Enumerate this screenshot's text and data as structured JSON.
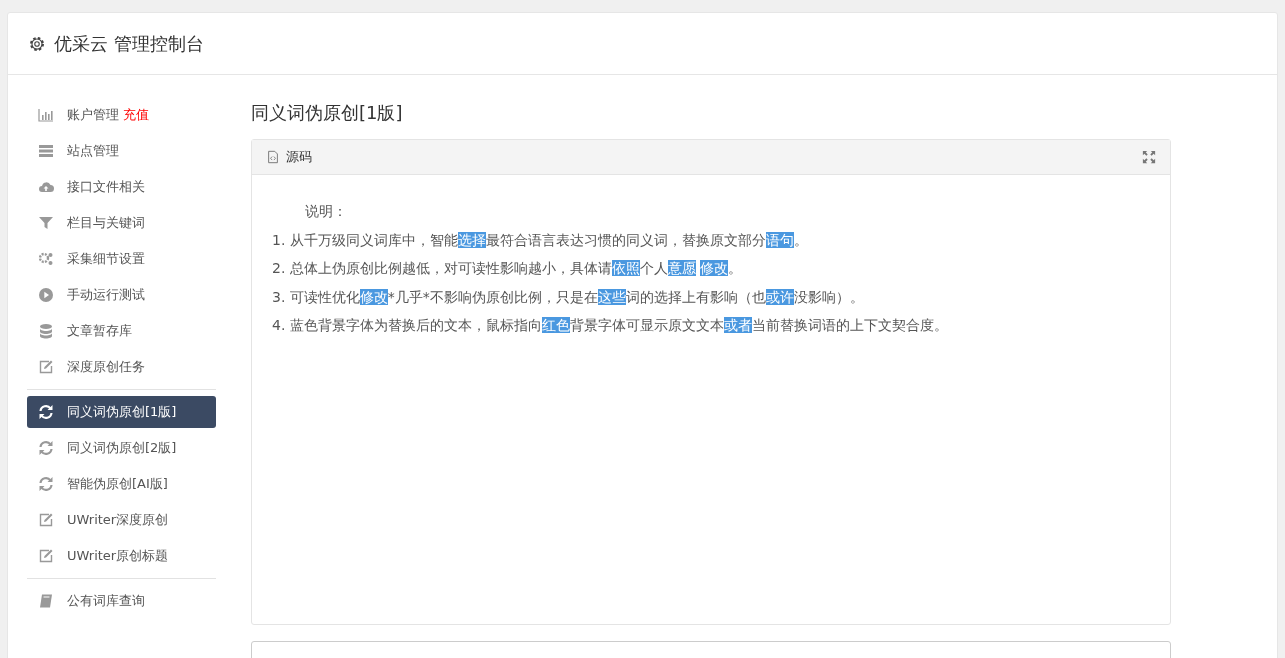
{
  "header": {
    "title": "优采云 管理控制台"
  },
  "sidebar": {
    "groups": [
      {
        "items": [
          {
            "kind": "chart",
            "label": "账户管理",
            "badge": "充值",
            "selected": false
          },
          {
            "kind": "server",
            "label": "站点管理",
            "selected": false
          },
          {
            "kind": "cloud",
            "label": "接口文件相关",
            "selected": false
          },
          {
            "kind": "filter",
            "label": "栏目与关键词",
            "selected": false
          },
          {
            "kind": "gears",
            "label": "采集细节设置",
            "selected": false
          },
          {
            "kind": "play",
            "label": "手动运行测试",
            "selected": false
          },
          {
            "kind": "database",
            "label": "文章暂存库",
            "selected": false
          },
          {
            "kind": "edit",
            "label": "深度原创任务",
            "selected": false
          }
        ]
      },
      {
        "items": [
          {
            "kind": "refresh",
            "label": "同义词伪原创[1版]",
            "selected": true
          },
          {
            "kind": "refresh",
            "label": "同义词伪原创[2版]",
            "selected": false
          },
          {
            "kind": "refresh",
            "label": "智能伪原创[AI版]",
            "selected": false
          },
          {
            "kind": "edit",
            "label": "UWriter深度原创",
            "selected": false
          },
          {
            "kind": "edit",
            "label": "UWriter原创标题",
            "selected": false
          }
        ]
      },
      {
        "items": [
          {
            "kind": "book",
            "label": "公有词库查询",
            "selected": false
          }
        ]
      }
    ]
  },
  "page_title": "同义词伪原创[1版]",
  "panel": {
    "title": "源码",
    "heading": "说明：",
    "lines": [
      {
        "number": "1.",
        "segments": [
          {
            "text": "从千万级同义词库中，智能",
            "highlighted": false
          },
          {
            "text": "选择",
            "highlighted": true
          },
          {
            "text": "最符合语言表达习惯的同义词，替换原文部分",
            "highlighted": false
          },
          {
            "text": "语句",
            "highlighted": true
          },
          {
            "text": "。",
            "highlighted": false
          }
        ]
      },
      {
        "number": "2.",
        "segments": [
          {
            "text": "总体上伪原创比例越低，对可读性影响越小，具体请",
            "highlighted": false
          },
          {
            "text": "依照",
            "highlighted": true
          },
          {
            "text": "个人",
            "highlighted": false
          },
          {
            "text": "意愿",
            "highlighted": true
          },
          {
            "text": "修改",
            "highlighted": true
          },
          {
            "text": "。",
            "highlighted": false
          }
        ]
      },
      {
        "number": "3.",
        "segments": [
          {
            "text": "可读性优化",
            "highlighted": false
          },
          {
            "text": "修改",
            "highlighted": true
          },
          {
            "text": "*几乎*不影响伪原创比例，只是在",
            "highlighted": false
          },
          {
            "text": "这些",
            "highlighted": true
          },
          {
            "text": "词的选择上有影响（也",
            "highlighted": false
          },
          {
            "text": "或许",
            "highlighted": true
          },
          {
            "text": "没影响）。",
            "highlighted": false
          }
        ]
      },
      {
        "number": "4.",
        "segments": [
          {
            "text": "蓝色背景字体为替换后的文本，鼠标指向",
            "highlighted": false
          },
          {
            "text": "红色",
            "highlighted": true
          },
          {
            "text": "背景字体可显示原文文本",
            "highlighted": false
          },
          {
            "text": "或者",
            "highlighted": true
          },
          {
            "text": "当前替换词语的上下文契合度。",
            "highlighted": false
          }
        ]
      }
    ]
  }
}
